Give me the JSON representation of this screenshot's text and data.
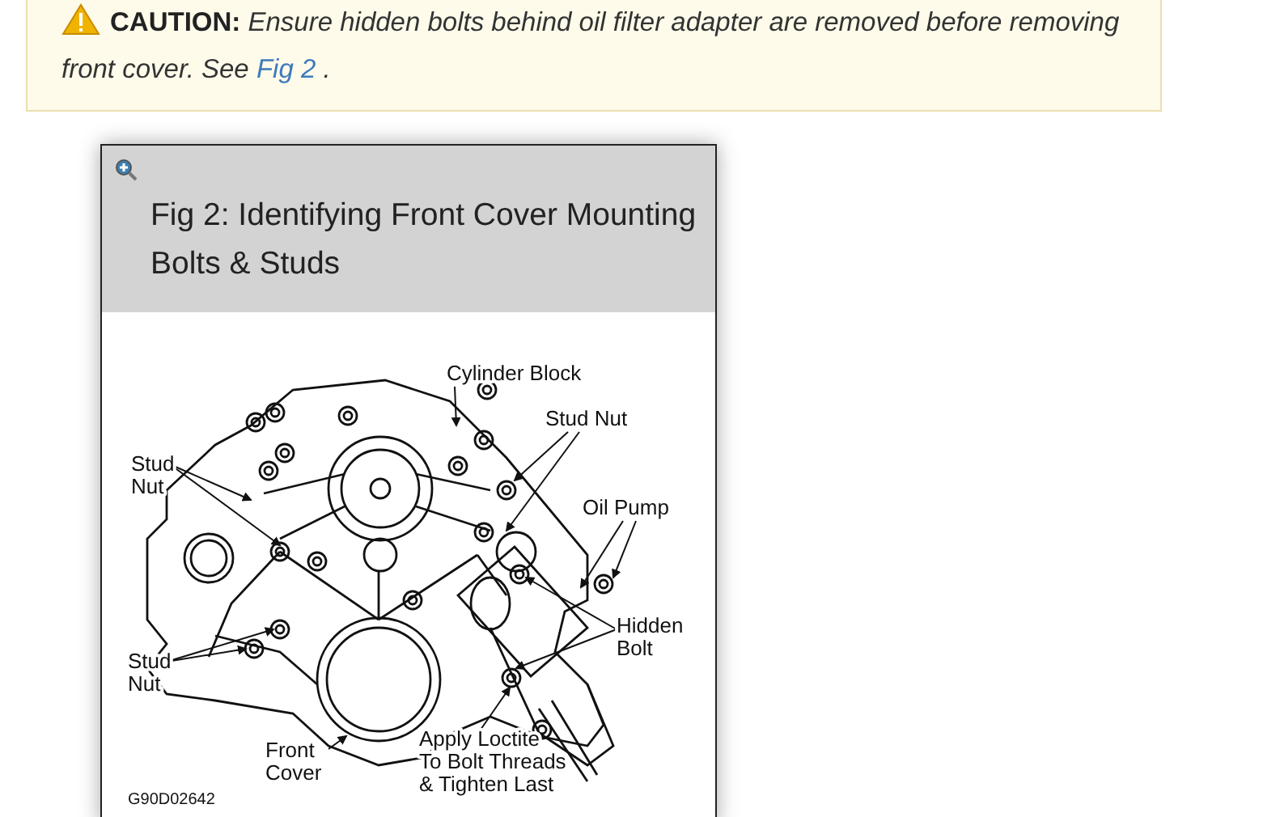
{
  "caution": {
    "label": "CAUTION:",
    "text": "Ensure hidden bolts behind oil filter adapter are removed before removing front cover. See",
    "link": "Fig 2",
    "after": " ."
  },
  "figure": {
    "title": "Fig 2: Identifying Front Cover Mounting Bolts & Studs",
    "callouts": [
      {
        "lines": [
          "Cylinder Block"
        ]
      },
      {
        "lines": [
          "Stud Nut"
        ]
      },
      {
        "lines": [
          "Stud",
          "Nut"
        ]
      },
      {
        "lines": [
          "Oil Pump"
        ]
      },
      {
        "lines": [
          "Hidden",
          "Bolt"
        ]
      },
      {
        "lines": [
          "Stud",
          "Nut"
        ]
      },
      {
        "lines": [
          "Front",
          "Cover"
        ]
      },
      {
        "lines": [
          "Apply Loctite",
          "To Bolt Threads",
          "& Tighten Last"
        ]
      }
    ],
    "code": "G90D02642"
  }
}
